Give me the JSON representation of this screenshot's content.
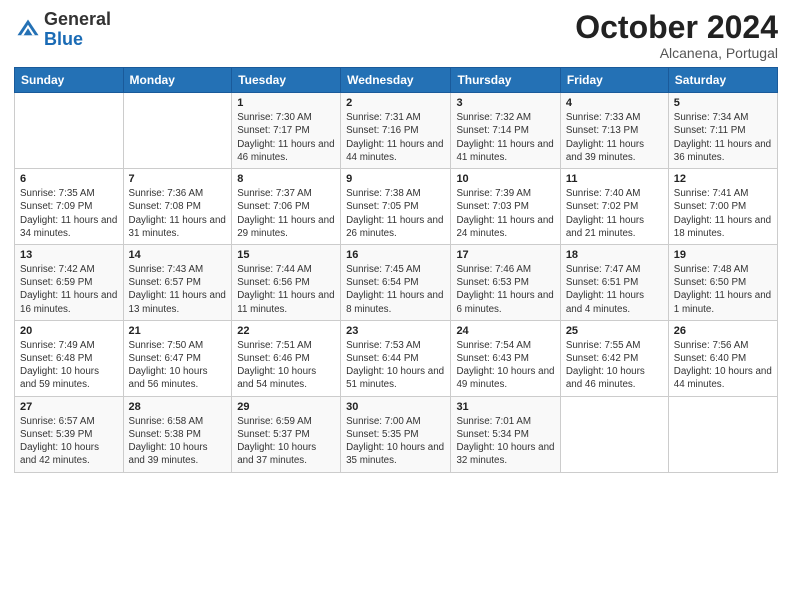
{
  "logo": {
    "general": "General",
    "blue": "Blue"
  },
  "header": {
    "title": "October 2024",
    "subtitle": "Alcanena, Portugal"
  },
  "days_of_week": [
    "Sunday",
    "Monday",
    "Tuesday",
    "Wednesday",
    "Thursday",
    "Friday",
    "Saturday"
  ],
  "weeks": [
    [
      {
        "day": "",
        "sunrise": "",
        "sunset": "",
        "daylight": ""
      },
      {
        "day": "",
        "sunrise": "",
        "sunset": "",
        "daylight": ""
      },
      {
        "day": "1",
        "sunrise": "Sunrise: 7:30 AM",
        "sunset": "Sunset: 7:17 PM",
        "daylight": "Daylight: 11 hours and 46 minutes."
      },
      {
        "day": "2",
        "sunrise": "Sunrise: 7:31 AM",
        "sunset": "Sunset: 7:16 PM",
        "daylight": "Daylight: 11 hours and 44 minutes."
      },
      {
        "day": "3",
        "sunrise": "Sunrise: 7:32 AM",
        "sunset": "Sunset: 7:14 PM",
        "daylight": "Daylight: 11 hours and 41 minutes."
      },
      {
        "day": "4",
        "sunrise": "Sunrise: 7:33 AM",
        "sunset": "Sunset: 7:13 PM",
        "daylight": "Daylight: 11 hours and 39 minutes."
      },
      {
        "day": "5",
        "sunrise": "Sunrise: 7:34 AM",
        "sunset": "Sunset: 7:11 PM",
        "daylight": "Daylight: 11 hours and 36 minutes."
      }
    ],
    [
      {
        "day": "6",
        "sunrise": "Sunrise: 7:35 AM",
        "sunset": "Sunset: 7:09 PM",
        "daylight": "Daylight: 11 hours and 34 minutes."
      },
      {
        "day": "7",
        "sunrise": "Sunrise: 7:36 AM",
        "sunset": "Sunset: 7:08 PM",
        "daylight": "Daylight: 11 hours and 31 minutes."
      },
      {
        "day": "8",
        "sunrise": "Sunrise: 7:37 AM",
        "sunset": "Sunset: 7:06 PM",
        "daylight": "Daylight: 11 hours and 29 minutes."
      },
      {
        "day": "9",
        "sunrise": "Sunrise: 7:38 AM",
        "sunset": "Sunset: 7:05 PM",
        "daylight": "Daylight: 11 hours and 26 minutes."
      },
      {
        "day": "10",
        "sunrise": "Sunrise: 7:39 AM",
        "sunset": "Sunset: 7:03 PM",
        "daylight": "Daylight: 11 hours and 24 minutes."
      },
      {
        "day": "11",
        "sunrise": "Sunrise: 7:40 AM",
        "sunset": "Sunset: 7:02 PM",
        "daylight": "Daylight: 11 hours and 21 minutes."
      },
      {
        "day": "12",
        "sunrise": "Sunrise: 7:41 AM",
        "sunset": "Sunset: 7:00 PM",
        "daylight": "Daylight: 11 hours and 18 minutes."
      }
    ],
    [
      {
        "day": "13",
        "sunrise": "Sunrise: 7:42 AM",
        "sunset": "Sunset: 6:59 PM",
        "daylight": "Daylight: 11 hours and 16 minutes."
      },
      {
        "day": "14",
        "sunrise": "Sunrise: 7:43 AM",
        "sunset": "Sunset: 6:57 PM",
        "daylight": "Daylight: 11 hours and 13 minutes."
      },
      {
        "day": "15",
        "sunrise": "Sunrise: 7:44 AM",
        "sunset": "Sunset: 6:56 PM",
        "daylight": "Daylight: 11 hours and 11 minutes."
      },
      {
        "day": "16",
        "sunrise": "Sunrise: 7:45 AM",
        "sunset": "Sunset: 6:54 PM",
        "daylight": "Daylight: 11 hours and 8 minutes."
      },
      {
        "day": "17",
        "sunrise": "Sunrise: 7:46 AM",
        "sunset": "Sunset: 6:53 PM",
        "daylight": "Daylight: 11 hours and 6 minutes."
      },
      {
        "day": "18",
        "sunrise": "Sunrise: 7:47 AM",
        "sunset": "Sunset: 6:51 PM",
        "daylight": "Daylight: 11 hours and 4 minutes."
      },
      {
        "day": "19",
        "sunrise": "Sunrise: 7:48 AM",
        "sunset": "Sunset: 6:50 PM",
        "daylight": "Daylight: 11 hours and 1 minute."
      }
    ],
    [
      {
        "day": "20",
        "sunrise": "Sunrise: 7:49 AM",
        "sunset": "Sunset: 6:48 PM",
        "daylight": "Daylight: 10 hours and 59 minutes."
      },
      {
        "day": "21",
        "sunrise": "Sunrise: 7:50 AM",
        "sunset": "Sunset: 6:47 PM",
        "daylight": "Daylight: 10 hours and 56 minutes."
      },
      {
        "day": "22",
        "sunrise": "Sunrise: 7:51 AM",
        "sunset": "Sunset: 6:46 PM",
        "daylight": "Daylight: 10 hours and 54 minutes."
      },
      {
        "day": "23",
        "sunrise": "Sunrise: 7:53 AM",
        "sunset": "Sunset: 6:44 PM",
        "daylight": "Daylight: 10 hours and 51 minutes."
      },
      {
        "day": "24",
        "sunrise": "Sunrise: 7:54 AM",
        "sunset": "Sunset: 6:43 PM",
        "daylight": "Daylight: 10 hours and 49 minutes."
      },
      {
        "day": "25",
        "sunrise": "Sunrise: 7:55 AM",
        "sunset": "Sunset: 6:42 PM",
        "daylight": "Daylight: 10 hours and 46 minutes."
      },
      {
        "day": "26",
        "sunrise": "Sunrise: 7:56 AM",
        "sunset": "Sunset: 6:40 PM",
        "daylight": "Daylight: 10 hours and 44 minutes."
      }
    ],
    [
      {
        "day": "27",
        "sunrise": "Sunrise: 6:57 AM",
        "sunset": "Sunset: 5:39 PM",
        "daylight": "Daylight: 10 hours and 42 minutes."
      },
      {
        "day": "28",
        "sunrise": "Sunrise: 6:58 AM",
        "sunset": "Sunset: 5:38 PM",
        "daylight": "Daylight: 10 hours and 39 minutes."
      },
      {
        "day": "29",
        "sunrise": "Sunrise: 6:59 AM",
        "sunset": "Sunset: 5:37 PM",
        "daylight": "Daylight: 10 hours and 37 minutes."
      },
      {
        "day": "30",
        "sunrise": "Sunrise: 7:00 AM",
        "sunset": "Sunset: 5:35 PM",
        "daylight": "Daylight: 10 hours and 35 minutes."
      },
      {
        "day": "31",
        "sunrise": "Sunrise: 7:01 AM",
        "sunset": "Sunset: 5:34 PM",
        "daylight": "Daylight: 10 hours and 32 minutes."
      },
      {
        "day": "",
        "sunrise": "",
        "sunset": "",
        "daylight": ""
      },
      {
        "day": "",
        "sunrise": "",
        "sunset": "",
        "daylight": ""
      }
    ]
  ]
}
